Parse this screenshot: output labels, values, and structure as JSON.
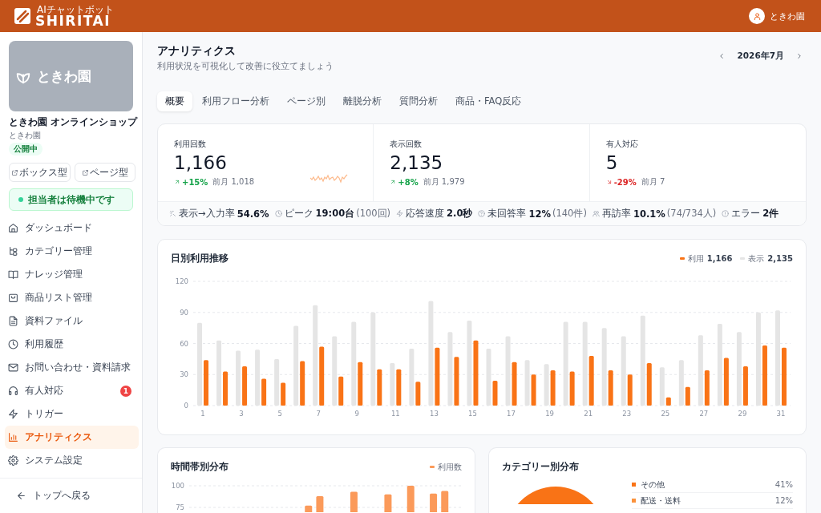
{
  "header": {
    "logo": {
      "tagline": "AIチャットボット",
      "name": "SHIRITAI"
    },
    "user": {
      "name": "ときわ園"
    }
  },
  "sidebar": {
    "shop": {
      "logo_text": "ときわ園",
      "name": "ときわ園 オンラインショップ",
      "owner": "ときわ園",
      "status": "公開中"
    },
    "buttons": [
      "ボックス型",
      "ページ型"
    ],
    "agent_status": {
      "text": "担当者は待機中です",
      "online": true
    },
    "nav": [
      {
        "label": "ダッシュボード",
        "selected": false
      },
      {
        "label": "カテゴリー管理",
        "selected": false
      },
      {
        "label": "ナレッジ管理",
        "selected": false
      },
      {
        "label": "商品リスト管理",
        "selected": false
      },
      {
        "label": "資料ファイル",
        "selected": false
      },
      {
        "label": "利用履歴",
        "selected": false
      },
      {
        "label": "お問い合わせ・資料請求",
        "selected": false
      },
      {
        "label": "有人対応",
        "selected": false,
        "badge": "1"
      },
      {
        "label": "トリガー",
        "selected": false
      },
      {
        "label": "アナリティクス",
        "selected": true
      },
      {
        "label": "システム設定",
        "selected": false
      }
    ],
    "back_link": "トップへ戻る"
  },
  "page": {
    "title": "アナリティクス",
    "subtitle": "利用状況を可視化して改善に役立てましょう",
    "period": "2026年7月"
  },
  "tabs": [
    {
      "label": "概要",
      "selected": true
    },
    {
      "label": "利用フロー分析",
      "selected": false
    },
    {
      "label": "ページ別",
      "selected": false
    },
    {
      "label": "離脱分析",
      "selected": false
    },
    {
      "label": "質問分析",
      "selected": false
    },
    {
      "label": "商品・FAQ反応",
      "selected": false
    }
  ],
  "kpis": [
    {
      "label": "利用回数",
      "value": "1,166",
      "change": "+15%",
      "increase": true,
      "previous": "前月 1,018",
      "sparkline": true
    },
    {
      "label": "表示回数",
      "value": "2,135",
      "change": "+8%",
      "increase": true,
      "previous": "前月 1,979",
      "sparkline": false
    },
    {
      "label": "有人対応",
      "value": "5",
      "change": "-29%",
      "increase": false,
      "previous": "前月 7",
      "sparkline": false
    }
  ],
  "stats": [
    {
      "label": "表示→入力率",
      "value": "54.6%"
    },
    {
      "label": "ピーク",
      "value": "19:00台",
      "note": "(100回)"
    },
    {
      "label": "応答速度",
      "value": "2.0秒"
    },
    {
      "label": "未回答率",
      "value": "12%",
      "note": "(140件)"
    },
    {
      "label": "再訪率",
      "value": "10.1%",
      "note": "(74/734人)"
    },
    {
      "label": "エラー",
      "value": "2件"
    }
  ],
  "daily_usage": {
    "title": "日別利用推移",
    "legend_totals": [
      "1,166",
      "2,135"
    ],
    "chart_data": {
      "type": "bar",
      "x": [
        1,
        2,
        3,
        4,
        5,
        6,
        7,
        8,
        9,
        10,
        11,
        12,
        13,
        14,
        15,
        16,
        17,
        18,
        19,
        20,
        21,
        22,
        23,
        24,
        25,
        26,
        27,
        28,
        29,
        30,
        31
      ],
      "series": [
        {
          "name": "利用",
          "color": "#f97316",
          "values": [
            44,
            33,
            38,
            26,
            22,
            43,
            57,
            28,
            42,
            35,
            35,
            23,
            56,
            47,
            63,
            24,
            42,
            30,
            34,
            33,
            48,
            34,
            30,
            41,
            8,
            18,
            34,
            46,
            38,
            58,
            56
          ]
        },
        {
          "name": "表示",
          "color": "#e5e5e5",
          "values": [
            80,
            63,
            53,
            54,
            45,
            77,
            97,
            67,
            81,
            90,
            41,
            55,
            101,
            71,
            82,
            55,
            67,
            44,
            40,
            81,
            81,
            75,
            67,
            87,
            37,
            44,
            68,
            79,
            71,
            90,
            92
          ]
        }
      ],
      "xlim": [
        0.5,
        31.5
      ],
      "ylim": [
        0,
        120
      ],
      "yticks": [
        0,
        30,
        60,
        90,
        120
      ],
      "xticks": [
        1,
        3,
        5,
        7,
        9,
        11,
        13,
        15,
        17,
        19,
        21,
        23,
        25,
        27,
        29,
        31
      ],
      "grid": true
    }
  },
  "hourly": {
    "title": "時間帯別分布",
    "chart_data": {
      "type": "bar",
      "series": [
        {
          "name": "利用数",
          "color": "#fb9a5a",
          "values": [
            null,
            null,
            null,
            null,
            null,
            null,
            null,
            null,
            null,
            null,
            77,
            88,
            null,
            null,
            93,
            null,
            null,
            90,
            null,
            100,
            null,
            91,
            94,
            null
          ]
        }
      ],
      "ylim": [
        0,
        100
      ],
      "yticks": [
        75,
        100
      ],
      "grid": true
    }
  },
  "category": {
    "title": "カテゴリー別分布",
    "legend": [
      {
        "label": "その他",
        "share": "41%",
        "color": "#f97316"
      },
      {
        "label": "配送・送料",
        "share": "12%",
        "color": "#fb923c"
      }
    ]
  }
}
